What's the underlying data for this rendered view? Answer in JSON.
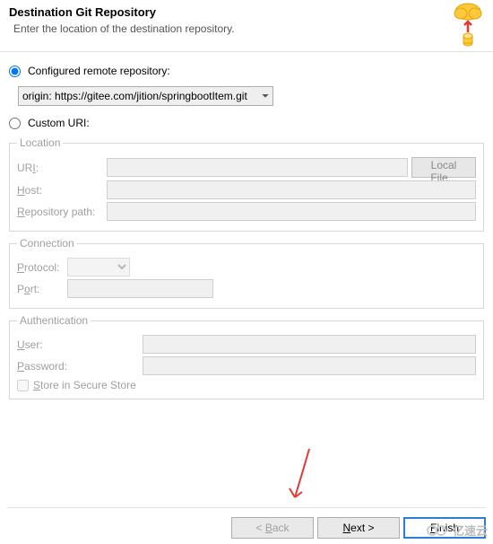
{
  "header": {
    "title": "Destination Git Repository",
    "subtitle": "Enter the location of the destination repository."
  },
  "options": {
    "configured_label": "Configured remote repository:",
    "configured_selected": "origin: https://gitee.com/jition/springbootItem.git",
    "custom_label": "Custom URI:"
  },
  "location": {
    "legend": "Location",
    "uri_label": "URI:",
    "uri_value": "",
    "local_file_btn": "Local File...",
    "host_label": "Host:",
    "host_value": "",
    "repo_path_label": "Repository path:",
    "repo_path_value": ""
  },
  "connection": {
    "legend": "Connection",
    "protocol_label": "Protocol:",
    "protocol_value": "",
    "port_label": "Port:",
    "port_value": ""
  },
  "auth": {
    "legend": "Authentication",
    "user_label": "User:",
    "user_value": "",
    "password_label": "Password:",
    "password_value": "",
    "store_label": "Store in Secure Store"
  },
  "buttons": {
    "back": "< Back",
    "next": "Next >",
    "finish": "Finish"
  },
  "watermark": "亿速云"
}
